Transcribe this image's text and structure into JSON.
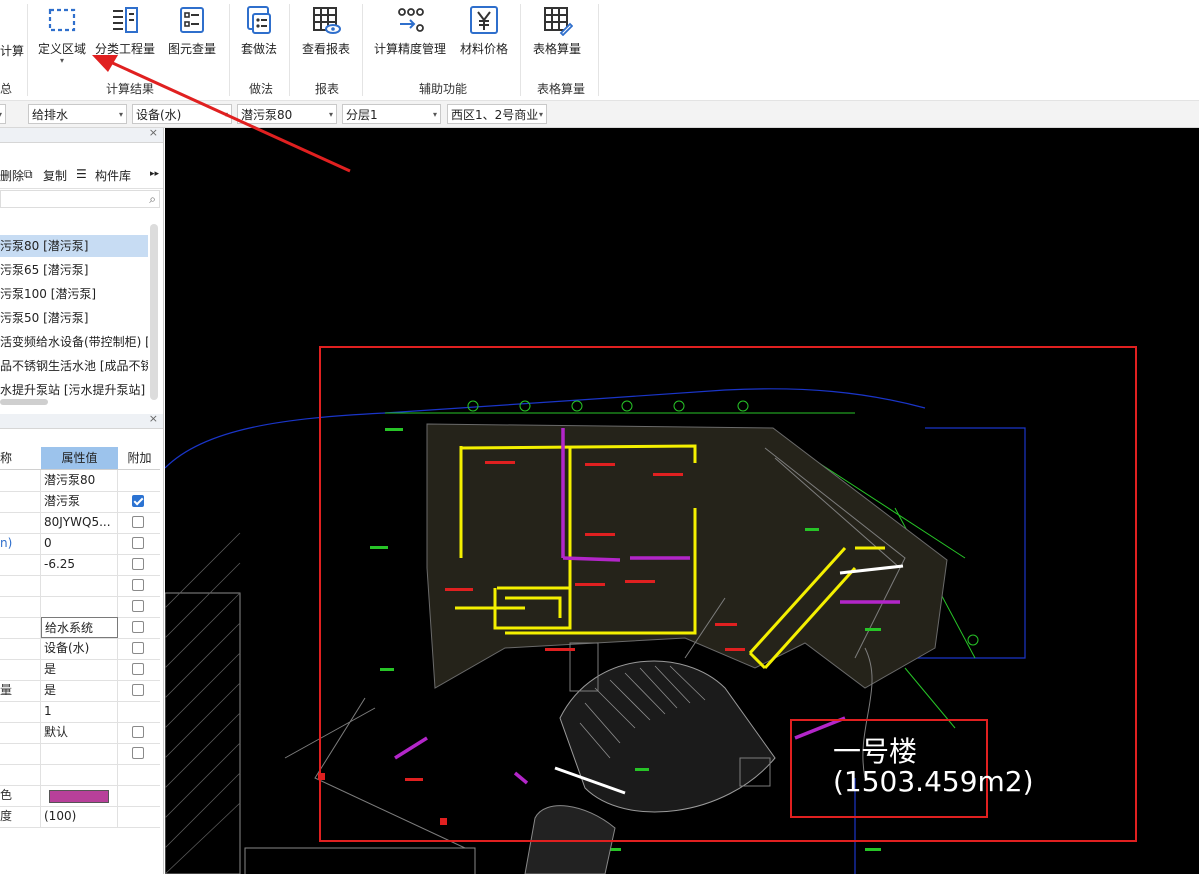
{
  "ribbon": {
    "partial_left_label": "计算",
    "partial_group_left": "总",
    "buttons": [
      {
        "id": "define-area",
        "label": "定义区域",
        "icon": "dashed-rect-icon"
      },
      {
        "id": "classify",
        "label": "分类工程量",
        "icon": "list-icon"
      },
      {
        "id": "element-qty",
        "label": "图元查量",
        "icon": "doc-icon"
      },
      {
        "id": "set-method",
        "label": "套做法",
        "icon": "set-method-icon"
      },
      {
        "id": "report",
        "label": "查看报表",
        "icon": "table-eye-icon"
      },
      {
        "id": "precision",
        "label": "计算精度管理",
        "icon": "precision-icon"
      },
      {
        "id": "price",
        "label": "材料价格",
        "icon": "yen-icon"
      },
      {
        "id": "table-calc",
        "label": "表格算量",
        "icon": "table-edit-icon"
      }
    ],
    "groups": {
      "calc_result": "计算结果",
      "method": "做法",
      "report": "报表",
      "aux": "辅助功能",
      "table": "表格算量"
    }
  },
  "dropdowns": [
    {
      "value": "给排水"
    },
    {
      "value": "设备(水)"
    },
    {
      "value": "潜污泵80"
    },
    {
      "value": "分层1"
    },
    {
      "value": "西区1、2号商业"
    }
  ],
  "component_panel": {
    "toolbar": {
      "delete": "删除",
      "copy": "复制",
      "library": "构件库"
    },
    "items": [
      "污泵80 [潜污泵]",
      "污泵65 [潜污泵]",
      "污泵100 [潜污泵]",
      "污泵50 [潜污泵]",
      "活变频给水设备(带控制柜) [设",
      "品不锈钢生活水池 [成品不锈",
      "水提升泵站 [污水提升泵站]"
    ],
    "selected_index": 0
  },
  "property_panel": {
    "headers": {
      "name": "称",
      "value": "属性值",
      "extra": "附加"
    },
    "rows": [
      {
        "name": "",
        "value": "潜污泵80",
        "cb": null
      },
      {
        "name": "",
        "value": "潜污泵",
        "cb": true
      },
      {
        "name": "",
        "value": "80JYWQ5...",
        "cb": false
      },
      {
        "name": "n)",
        "value": "0",
        "cb": false
      },
      {
        "name": "",
        "value": "-6.25",
        "cb": false
      },
      {
        "name": "",
        "value": "",
        "cb": false
      },
      {
        "name": "",
        "value": "",
        "cb": false
      },
      {
        "name": "",
        "value": "给水系统",
        "cb": false
      },
      {
        "name": "",
        "value": "设备(水)",
        "cb": false
      },
      {
        "name": "",
        "value": "是",
        "cb": false
      },
      {
        "name": "量",
        "value": "是",
        "cb": false
      },
      {
        "name": "",
        "value": "1",
        "cb": null
      },
      {
        "name": "",
        "value": "默认",
        "cb": false
      },
      {
        "name": "",
        "value": "",
        "cb": false
      },
      {
        "name": "",
        "value": "",
        "cb": null
      },
      {
        "name": "色",
        "value": "",
        "cb": null
      },
      {
        "name": "度",
        "value": "(100)",
        "cb": null
      }
    ],
    "color_swatch": "#b8409a"
  },
  "canvas": {
    "annotation_title": "一号楼",
    "annotation_area": "(1503.459m2)"
  },
  "colors": {
    "highlight_red": "#e02020",
    "cad_yellow": "#f4f000",
    "cad_magenta": "#b326c9",
    "cad_green": "#27c427",
    "cad_blue": "#1a35c8"
  }
}
